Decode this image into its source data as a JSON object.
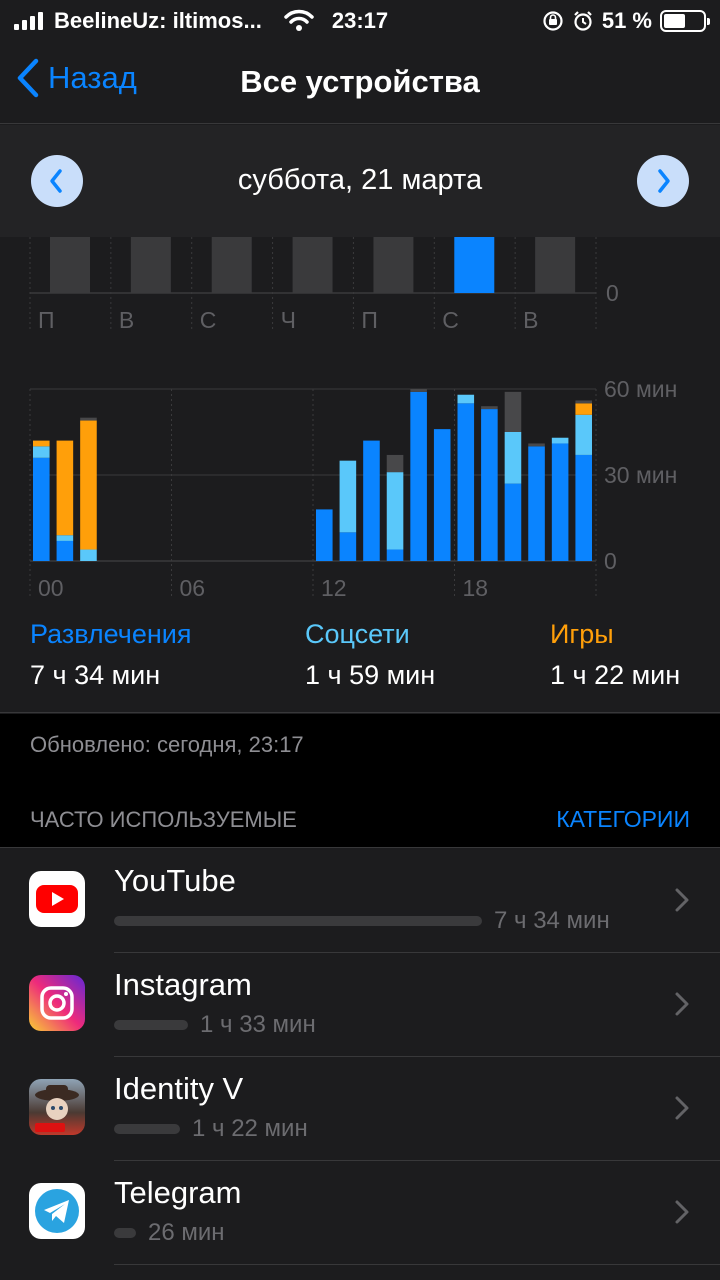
{
  "status_bar": {
    "carrier": "BeelineUz: iltimos...",
    "time": "23:17",
    "battery": "51 %"
  },
  "nav": {
    "back_label": "Назад",
    "title": "Все устройства"
  },
  "date_nav": {
    "date_label": "суббота, 21 марта"
  },
  "chart_data": [
    {
      "type": "bar",
      "categories": [
        "П",
        "В",
        "С",
        "Ч",
        "П",
        "С",
        "В"
      ],
      "selected": "С",
      "y_tick_visible": "0",
      "colors": {
        "default": "#3a3a3c",
        "selected": "#0a84ff"
      }
    },
    {
      "type": "bar",
      "stacked": true,
      "x_ticks": [
        "00",
        "06",
        "12",
        "18"
      ],
      "y_ticks": [
        "60 мин",
        "30 мин",
        "0"
      ],
      "ylim": [
        0,
        60
      ],
      "hours": [
        0,
        1,
        2,
        3,
        4,
        5,
        6,
        7,
        8,
        9,
        10,
        11,
        12,
        13,
        14,
        15,
        16,
        17,
        18,
        19,
        20,
        21,
        22,
        23
      ],
      "series": [
        {
          "name": "Развлечения",
          "color": "#0a84ff",
          "values": [
            36,
            7,
            0,
            0,
            0,
            0,
            0,
            0,
            0,
            0,
            0,
            0,
            18,
            10,
            42,
            4,
            59,
            46,
            55,
            53,
            27,
            40,
            41,
            37
          ]
        },
        {
          "name": "Соцсети",
          "color": "#5ac8fa",
          "values": [
            4,
            2,
            4,
            0,
            0,
            0,
            0,
            0,
            0,
            0,
            0,
            0,
            0,
            25,
            0,
            27,
            0,
            0,
            3,
            0,
            18,
            0,
            2,
            14
          ]
        },
        {
          "name": "Игры",
          "color": "#ff9f0a",
          "values": [
            2,
            33,
            45,
            0,
            0,
            0,
            0,
            0,
            0,
            0,
            0,
            0,
            0,
            0,
            0,
            0,
            0,
            0,
            0,
            0,
            0,
            0,
            0,
            4
          ]
        },
        {
          "name": "other",
          "color": "#48484a",
          "values": [
            0,
            0,
            1,
            0,
            0,
            0,
            0,
            0,
            0,
            0,
            0,
            0,
            0,
            0,
            0,
            6,
            1,
            0,
            0,
            1,
            14,
            1,
            0,
            1
          ]
        }
      ]
    }
  ],
  "categories": [
    {
      "name": "Развлечения",
      "value": "7 ч 34 мин",
      "color": "#0a84ff"
    },
    {
      "name": "Соцсети",
      "value": "1 ч 59 мин",
      "color": "#5ac8fa"
    },
    {
      "name": "Игры",
      "value": "1 ч 22 мин",
      "color": "#ff9f0a"
    }
  ],
  "updated": "Обновлено: сегодня, 23:17",
  "frequent_header": "ЧАСТО ИСПОЛЬЗУЕМЫЕ",
  "categories_link": "КАТЕГОРИИ",
  "apps": [
    {
      "name": "YouTube",
      "time": "7 ч 34 мин",
      "usage_fraction": 1.0,
      "icon": "youtube-icon"
    },
    {
      "name": "Instagram",
      "time": "1 ч 33 мин",
      "usage_fraction": 0.2,
      "icon": "instagram-icon"
    },
    {
      "name": "Identity V",
      "time": "1 ч 22 мин",
      "usage_fraction": 0.18,
      "icon": "identity-v-icon"
    },
    {
      "name": "Telegram",
      "time": "26 мин",
      "usage_fraction": 0.06,
      "icon": "telegram-icon"
    }
  ]
}
